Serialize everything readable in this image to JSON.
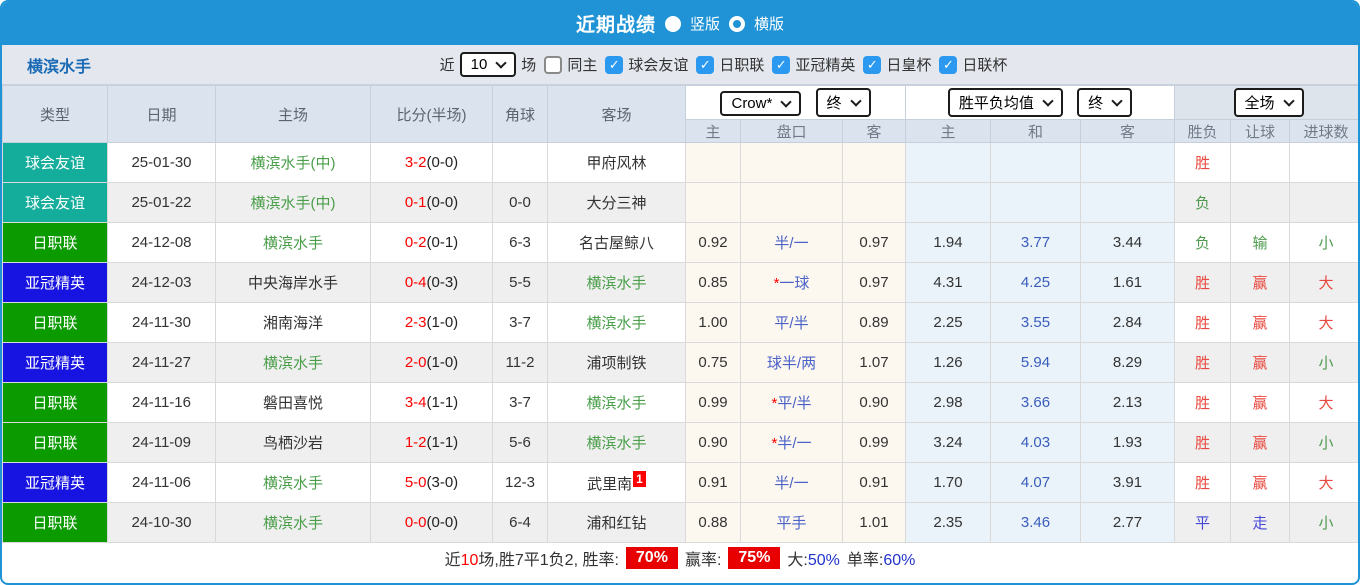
{
  "title_bar": {
    "title": "近期战绩",
    "radio1_label": "竖版",
    "radio2_label": "横版"
  },
  "team_bar": {
    "team_name": "横滨水手",
    "near_label": "近",
    "count_value": "10",
    "games_label": "场",
    "same_home_label": "同主",
    "same_home_checked": false,
    "leagues": [
      {
        "label": "球会友谊",
        "checked": true
      },
      {
        "label": "日职联",
        "checked": true
      },
      {
        "label": "亚冠精英",
        "checked": true
      },
      {
        "label": "日皇杯",
        "checked": true
      },
      {
        "label": "日联杯",
        "checked": true
      }
    ]
  },
  "controls": {
    "bookmaker": "Crow*",
    "bookmaker_state": "终",
    "europe_odds": "胜平负均值",
    "europe_state": "终",
    "scope": "全场"
  },
  "columns": {
    "type": "类型",
    "date": "日期",
    "home": "主场",
    "score": "比分(半场)",
    "corner": "角球",
    "away": "客场",
    "sub": [
      "主",
      "盘口",
      "客",
      "主",
      "和",
      "客",
      "胜负",
      "让球",
      "进球数"
    ]
  },
  "table": {
    "rows": [
      {
        "type": "球会友谊",
        "date": "25-01-30",
        "home": "横滨水手(中)",
        "home_self": true,
        "score": "3-2",
        "half": "0-0",
        "corner": "",
        "away": "甲府风林",
        "away_self": false,
        "away_sup": "",
        "ah_home": "",
        "ah_line": "",
        "ah_star": false,
        "ah_away": "",
        "eu_home": "",
        "eu_draw": "",
        "eu_away": "",
        "result": "胜",
        "ah_result": "",
        "goals_result": ""
      },
      {
        "type": "球会友谊",
        "date": "25-01-22",
        "home": "横滨水手(中)",
        "home_self": true,
        "score": "0-1",
        "half": "0-0",
        "corner": "0-0",
        "away": "大分三神",
        "away_self": false,
        "away_sup": "",
        "ah_home": "",
        "ah_line": "",
        "ah_star": false,
        "ah_away": "",
        "eu_home": "",
        "eu_draw": "",
        "eu_away": "",
        "result": "负",
        "ah_result": "",
        "goals_result": ""
      },
      {
        "type": "日职联",
        "date": "24-12-08",
        "home": "横滨水手",
        "home_self": true,
        "score": "0-2",
        "half": "0-1",
        "corner": "6-3",
        "away": "名古屋鲸八",
        "away_self": false,
        "away_sup": "",
        "ah_home": "0.92",
        "ah_line": "半/一",
        "ah_star": false,
        "ah_away": "0.97",
        "eu_home": "1.94",
        "eu_draw": "3.77",
        "eu_away": "3.44",
        "result": "负",
        "ah_result": "输",
        "goals_result": "小"
      },
      {
        "type": "亚冠精英",
        "date": "24-12-03",
        "home": "中央海岸水手",
        "home_self": false,
        "score": "0-4",
        "half": "0-3",
        "corner": "5-5",
        "away": "横滨水手",
        "away_self": true,
        "away_sup": "",
        "ah_home": "0.85",
        "ah_line": "一球",
        "ah_star": true,
        "ah_away": "0.97",
        "eu_home": "4.31",
        "eu_draw": "4.25",
        "eu_away": "1.61",
        "result": "胜",
        "ah_result": "赢",
        "goals_result": "大"
      },
      {
        "type": "日职联",
        "date": "24-11-30",
        "home": "湘南海洋",
        "home_self": false,
        "score": "2-3",
        "half": "1-0",
        "corner": "3-7",
        "away": "横滨水手",
        "away_self": true,
        "away_sup": "",
        "ah_home": "1.00",
        "ah_line": "平/半",
        "ah_star": false,
        "ah_away": "0.89",
        "eu_home": "2.25",
        "eu_draw": "3.55",
        "eu_away": "2.84",
        "result": "胜",
        "ah_result": "赢",
        "goals_result": "大"
      },
      {
        "type": "亚冠精英",
        "date": "24-11-27",
        "home": "横滨水手",
        "home_self": true,
        "score": "2-0",
        "half": "1-0",
        "corner": "11-2",
        "away": "浦项制铁",
        "away_self": false,
        "away_sup": "",
        "ah_home": "0.75",
        "ah_line": "球半/两",
        "ah_star": false,
        "ah_away": "1.07",
        "eu_home": "1.26",
        "eu_draw": "5.94",
        "eu_away": "8.29",
        "result": "胜",
        "ah_result": "赢",
        "goals_result": "小"
      },
      {
        "type": "日职联",
        "date": "24-11-16",
        "home": "磐田喜悦",
        "home_self": false,
        "score": "3-4",
        "half": "1-1",
        "corner": "3-7",
        "away": "横滨水手",
        "away_self": true,
        "away_sup": "",
        "ah_home": "0.99",
        "ah_line": "平/半",
        "ah_star": true,
        "ah_away": "0.90",
        "eu_home": "2.98",
        "eu_draw": "3.66",
        "eu_away": "2.13",
        "result": "胜",
        "ah_result": "赢",
        "goals_result": "大"
      },
      {
        "type": "日职联",
        "date": "24-11-09",
        "home": "鸟栖沙岩",
        "home_self": false,
        "score": "1-2",
        "half": "1-1",
        "corner": "5-6",
        "away": "横滨水手",
        "away_self": true,
        "away_sup": "",
        "ah_home": "0.90",
        "ah_line": "半/一",
        "ah_star": true,
        "ah_away": "0.99",
        "eu_home": "3.24",
        "eu_draw": "4.03",
        "eu_away": "1.93",
        "result": "胜",
        "ah_result": "赢",
        "goals_result": "小"
      },
      {
        "type": "亚冠精英",
        "date": "24-11-06",
        "home": "横滨水手",
        "home_self": true,
        "score": "5-0",
        "half": "3-0",
        "corner": "12-3",
        "away": "武里南",
        "away_self": false,
        "away_sup": "1",
        "ah_home": "0.91",
        "ah_line": "半/一",
        "ah_star": false,
        "ah_away": "0.91",
        "eu_home": "1.70",
        "eu_draw": "4.07",
        "eu_away": "3.91",
        "result": "胜",
        "ah_result": "赢",
        "goals_result": "大"
      },
      {
        "type": "日职联",
        "date": "24-10-30",
        "home": "横滨水手",
        "home_self": true,
        "score": "0-0",
        "half": "0-0",
        "corner": "6-4",
        "away": "浦和红钻",
        "away_self": false,
        "away_sup": "",
        "ah_home": "0.88",
        "ah_line": "平手",
        "ah_star": false,
        "ah_away": "1.01",
        "eu_home": "2.35",
        "eu_draw": "3.46",
        "eu_away": "2.77",
        "result": "平",
        "ah_result": "走",
        "goals_result": "小"
      }
    ]
  },
  "footer": {
    "part1": "近",
    "count": "10",
    "part2": "场,胜7平1负2, 胜率:",
    "win_rate": "70%",
    "part3": "赢率:",
    "profit_rate": "75%",
    "big_label": "大:",
    "big_value": "50%",
    "single_label": "单率:",
    "single_value": "60%"
  },
  "colors": {
    "accent_blue": "#1f93d5",
    "score_red": "#ff0000",
    "self_team_green": "#4a9e4a",
    "handicap_line_blue": "#4a62c8",
    "draw_odds_blue": "#3a5dbb",
    "type_badges": {
      "球会友谊": "#14ad9b",
      "日职联": "#0b9a00",
      "亚冠精英": "#1713e1"
    },
    "result_map": {
      "胜": "#e9493f",
      "负": "#4e9a4e",
      "平": "#4646d8",
      "赢": "#e9493f",
      "输": "#4e9a4e",
      "走": "#4646d8",
      "大": "#e9493f",
      "小": "#4e9a4e"
    }
  }
}
